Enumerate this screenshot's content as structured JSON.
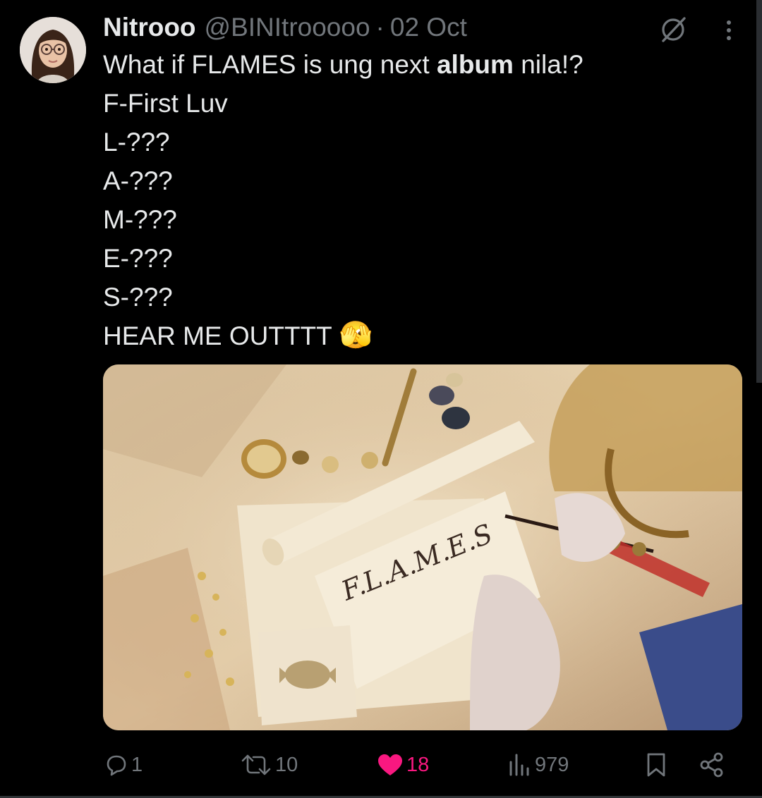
{
  "post": {
    "display_name": "Nitrooo",
    "handle": "@BINItrooooo",
    "separator": "·",
    "date": "02 Oct",
    "text_prefix": "What if FLAMES is ung next ",
    "text_bold": "album",
    "text_suffix": " nila!?",
    "lines": [
      "F-First Luv",
      "L-???",
      "A-???",
      "M-???",
      "E-???",
      "S-???"
    ],
    "last_line": "HEAR ME OUTTTT",
    "emoji": "🫣",
    "image_lettering": "F.L.A.M.E.S"
  },
  "actions": {
    "reply_count": "1",
    "repost_count": "10",
    "like_count": "18",
    "view_count": "979"
  },
  "colors": {
    "background": "#000000",
    "text": "#e7e9ea",
    "muted": "#71767b",
    "like": "#f91880"
  },
  "icons": [
    "grok-icon",
    "more-icon",
    "reply-icon",
    "repost-icon",
    "like-icon",
    "views-icon",
    "bookmark-icon",
    "share-icon"
  ]
}
